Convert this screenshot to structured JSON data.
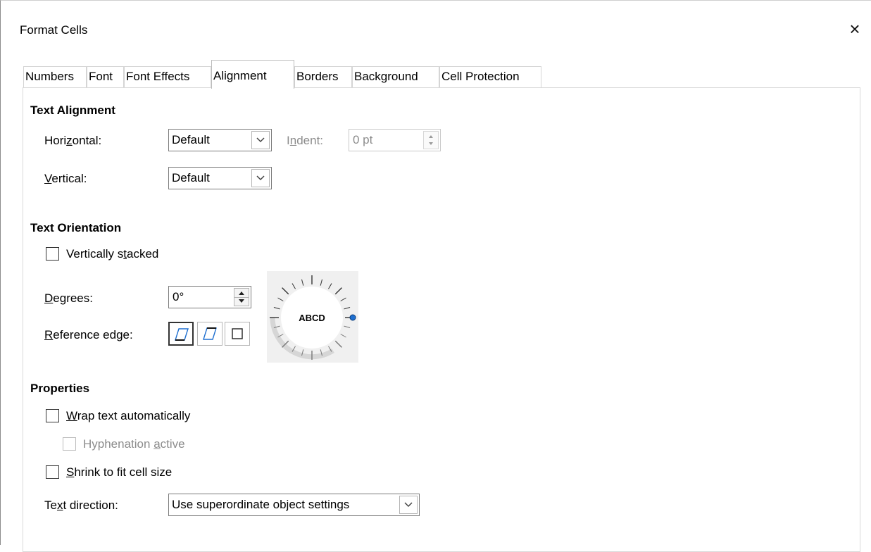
{
  "window": {
    "title": "Format Cells",
    "close_glyph": "×"
  },
  "tabs": [
    {
      "label": "Numbers"
    },
    {
      "label": "Font"
    },
    {
      "label": "Font Effects"
    },
    {
      "label": "Alignment"
    },
    {
      "label": "Borders"
    },
    {
      "label": "Background"
    },
    {
      "label": "Cell Protection"
    }
  ],
  "active_tab": "Alignment",
  "text_alignment": {
    "heading": "Text Alignment",
    "horizontal_label_pre": "Hori",
    "horizontal_label_key": "z",
    "horizontal_label_post": "ontal:",
    "horizontal_value": "Default",
    "indent_label_pre": "I",
    "indent_label_key": "n",
    "indent_label_post": "dent:",
    "indent_value": "0 pt",
    "vertical_label_key": "V",
    "vertical_label_post": "ertical:",
    "vertical_value": "Default"
  },
  "text_orientation": {
    "heading": "Text Orientation",
    "stacked_label_pre": "Vertically s",
    "stacked_label_key": "t",
    "stacked_label_post": "acked",
    "stacked_checked": false,
    "degrees_label_key": "D",
    "degrees_label_post": "egrees:",
    "degrees_value": "0°",
    "reference_label_key": "R",
    "reference_label_post": "eference edge:",
    "dial_text": "ABCD",
    "dial_angle_deg": 0
  },
  "properties": {
    "heading": "Properties",
    "wrap_label_key": "W",
    "wrap_label_post": "rap text automatically",
    "wrap_checked": false,
    "hyphen_label_pre": "Hyphenation ",
    "hyphen_label_key": "a",
    "hyphen_label_post": "ctive",
    "hyphen_checked": false,
    "shrink_label_key": "S",
    "shrink_label_post": "hrink to fit cell size",
    "shrink_checked": false,
    "direction_label_pre": "Te",
    "direction_label_key": "x",
    "direction_label_post": "t direction:",
    "direction_value": "Use superordinate object settings"
  },
  "colors": {
    "dial_marker": "#1e6fd0",
    "disabled_text": "#8c8c8c"
  },
  "icons": [
    "close-icon",
    "chevron-down-icon",
    "spin-up-down-icon",
    "reference-edge-bottom-icon",
    "reference-edge-top-icon",
    "reference-edge-inside-icon"
  ]
}
